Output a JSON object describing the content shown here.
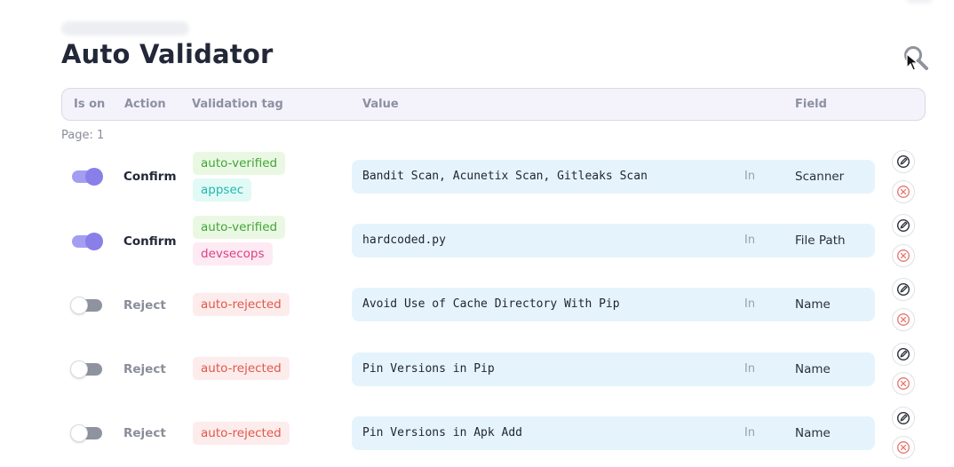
{
  "page": {
    "title": "Auto Validator",
    "page_label": "Page: 1"
  },
  "table": {
    "headers": {
      "is_on": "Is on",
      "action": "Action",
      "validation_tag": "Validation tag",
      "value": "Value",
      "field": "Field"
    },
    "rows": [
      {
        "is_on": true,
        "action": "Confirm",
        "tags": [
          {
            "label": "auto-verified",
            "color": "#3fa636"
          },
          {
            "label": "appsec",
            "color": "#1fb9b0"
          }
        ],
        "value": "Bandit Scan, Acunetix Scan, Gitleaks Scan",
        "operator": "In",
        "field": "Scanner"
      },
      {
        "is_on": true,
        "action": "Confirm",
        "tags": [
          {
            "label": "auto-verified",
            "color": "#3fa636"
          },
          {
            "label": "devsecops",
            "color": "#dd3f86"
          }
        ],
        "value": "hardcoded.py",
        "operator": "In",
        "field": "File Path"
      },
      {
        "is_on": false,
        "action": "Reject",
        "tags": [
          {
            "label": "auto-rejected",
            "color": "#e0574a"
          }
        ],
        "value": "Avoid Use of Cache Directory With Pip",
        "operator": "In",
        "field": "Name"
      },
      {
        "is_on": false,
        "action": "Reject",
        "tags": [
          {
            "label": "auto-rejected",
            "color": "#e0574a"
          }
        ],
        "value": "Pin Versions in Pip",
        "operator": "In",
        "field": "Name"
      },
      {
        "is_on": false,
        "action": "Reject",
        "tags": [
          {
            "label": "auto-rejected",
            "color": "#e0574a"
          }
        ],
        "value": "Pin Versions in Apk Add",
        "operator": "In",
        "field": "Name"
      }
    ],
    "row_icons": {
      "edit": "edit-pencil-icon",
      "delete": "delete-x-icon"
    }
  },
  "icons": {
    "search": "search-icon"
  },
  "colors": {
    "accent": "#8a7ee8",
    "value_bg": "#e5f4fc",
    "delete": "#e8736b"
  }
}
